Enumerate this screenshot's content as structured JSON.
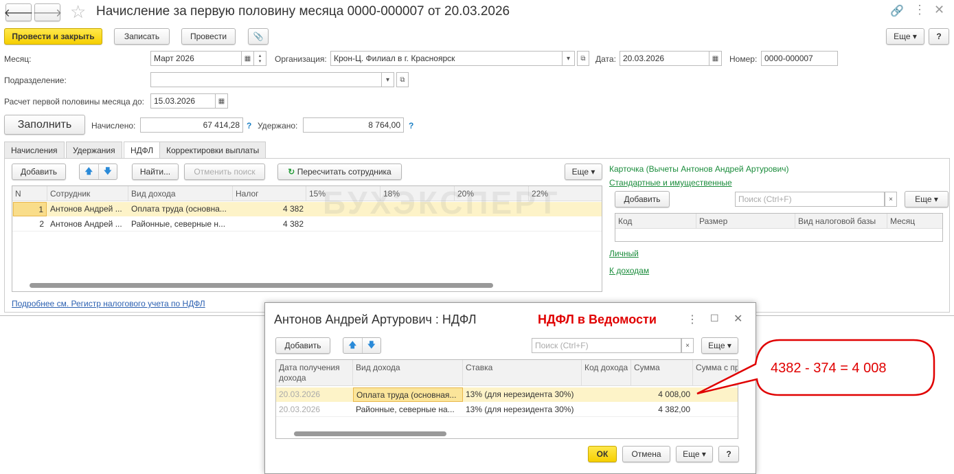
{
  "window": {
    "title": "Начисление за первую половину месяца 0000-000007 от 20.03.2026"
  },
  "toolbar": {
    "post_close": "Провести и закрыть",
    "save": "Записать",
    "post": "Провести",
    "more": "Еще",
    "help": "?"
  },
  "form": {
    "month_label": "Месяц:",
    "month": "Март 2026",
    "org_label": "Организация:",
    "org": "Крон-Ц. Филиал в г. Красноярск",
    "date_label": "Дата:",
    "date": "20.03.2026",
    "number_label": "Номер:",
    "number": "0000-000007",
    "dept_label": "Подразделение:",
    "dept": "",
    "calc_label": "Расчет первой половины месяца до:",
    "calc_date": "15.03.2026",
    "fill": "Заполнить",
    "accrued_label": "Начислено:",
    "accrued": "67 414,28",
    "withheld_label": "Удержано:",
    "withheld": "8 764,00",
    "hint": "?"
  },
  "tabs": [
    "Начисления",
    "Удержания",
    "НДФЛ",
    "Корректировки выплаты"
  ],
  "ndfl": {
    "add": "Добавить",
    "find": "Найти...",
    "cancel_search": "Отменить поиск",
    "recalc": "Пересчитать сотрудника",
    "more": "Еще",
    "columns": [
      "N",
      "Сотрудник",
      "Вид дохода",
      "Налог",
      "15%",
      "18%",
      "20%",
      "22%"
    ],
    "rows": [
      {
        "n": "1",
        "employee": "Антонов Андрей ...",
        "income": "Оплата труда (основна...",
        "tax": "4 382"
      },
      {
        "n": "2",
        "employee": "Антонов Андрей ...",
        "income": "Районные, северные н...",
        "tax": "4 382"
      }
    ],
    "register_link": "Подробнее см. Регистр налогового учета по НДФЛ"
  },
  "card": {
    "title": "Карточка (Вычеты Антонов Андрей Артурович)",
    "standard_link": "Стандартные и имущественные",
    "add": "Добавить",
    "search_placeholder": "Поиск (Ctrl+F)",
    "more": "Еще",
    "columns": [
      "Код",
      "Размер",
      "Вид налоговой базы",
      "Месяц"
    ],
    "personal_link": "Личный",
    "income_link": "К доходам"
  },
  "watermark": "БУХЭКСПЕРТ",
  "dialog": {
    "title": "Антонов Андрей Артурович : НДФЛ",
    "annotation": "НДФЛ в Ведомости",
    "add": "Добавить",
    "search_placeholder": "Поиск (Ctrl+F)",
    "more": "Еще",
    "columns": [
      "Дата получения дохода",
      "Вид дохода",
      "Ставка",
      "Код дохода",
      "Сумма",
      "Сумма с пр"
    ],
    "rows": [
      {
        "date": "20.03.2026",
        "income": "Оплата труда (основная...",
        "rate": "13% (для нерезидента 30%)",
        "code": "",
        "sum": "4 008,00"
      },
      {
        "date": "20.03.2026",
        "income": "Районные, северные на...",
        "rate": "13% (для нерезидента 30%)",
        "code": "",
        "sum": "4 382,00"
      }
    ],
    "ok": "ОК",
    "cancel": "Отмена",
    "dialog_more": "Еще",
    "help": "?"
  },
  "callout": "4382 - 374 = 4 008"
}
